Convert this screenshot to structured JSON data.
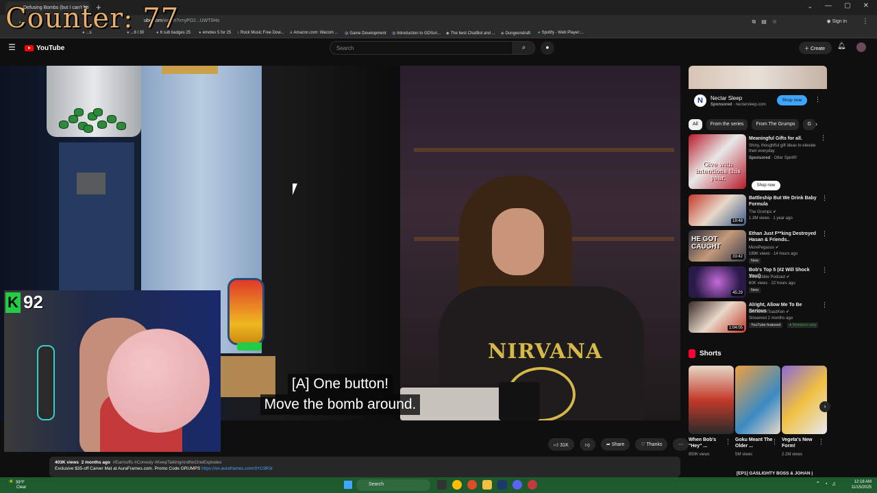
{
  "browser": {
    "tab_title": "Defusing Bombs (but I can't he",
    "url_host": "ube.com",
    "url_path": "/watch?v=yPOJ...UWT0Ho",
    "sign_in": "Sign in",
    "bookmarks": [
      {
        "label": "...s",
        "icon": "emote-icon"
      },
      {
        "label": "...6 l 30",
        "icon": "emote-icon"
      },
      {
        "label": "6 sub badges 25",
        "icon": "emote-icon"
      },
      {
        "label": "emotes 5 for 25",
        "icon": "emote-icon"
      },
      {
        "label": "Rock Music Free Dow...",
        "icon": "music-icon"
      },
      {
        "label": "Amazon.com: Wacom ...",
        "icon": "amazon-icon"
      },
      {
        "label": "Game Development",
        "icon": "globe-icon"
      },
      {
        "label": "Introduction to GDScri...",
        "icon": "globe-icon"
      },
      {
        "label": "The best ChatBot and ...",
        "icon": "bot-icon"
      },
      {
        "label": "Dungeondraft",
        "icon": "map-icon"
      },
      {
        "label": "Spotify - Web Player:...",
        "icon": "spotify-icon"
      }
    ]
  },
  "overlay": {
    "counter": "Counter: 77",
    "xp_letter": "K",
    "xp_value": "92"
  },
  "youtube": {
    "logo_text": "YouTube",
    "search_placeholder": "Search",
    "create_label": "Create"
  },
  "video": {
    "caption_line1": "[A] One button!",
    "caption_line2": "Move the bomb around.",
    "shirt_text": "NIRVANA"
  },
  "actions": {
    "likes": "31K",
    "share": "Share",
    "thanks": "Thanks"
  },
  "description": {
    "views": "403K views",
    "age": "2 months ago",
    "tags": "#Earmuffs #Comedy #KeepTalkingAndNoOneExplodes",
    "promo": "Exclusive $35-off Carver Mat at AuraFrames.com. Promo Code GRUMPS",
    "link": "https://on.auraframes.com/3YC9R3r"
  },
  "sidebar": {
    "ad": {
      "name": "Nectar Sleep",
      "sponsored": "Sponsored",
      "domain": "nectarsleep.com",
      "cta": "Shop now"
    },
    "chips": [
      "All",
      "From the series",
      "From The Grumps",
      "G"
    ],
    "gift_ad": {
      "title": "Meaningful Gifts for all.",
      "desc": "Shiny, thoughtful gift ideas to elevate their everyday",
      "sponsored": "Sponsored",
      "advertiser": "Otter Spirit®",
      "thumb_text": "Give with intentions this year.",
      "cta": "Shop now"
    },
    "recs": [
      {
        "title": "Battleship But We Drink Baby Formula",
        "channel": "The Grumps",
        "meta": "1.3M views · 1 year ago",
        "duration": "19:48",
        "badge": ""
      },
      {
        "title": "Ethan Just F**king Destroyed Hasan & Friends..",
        "channel": "MorePegasus",
        "meta": "189K views · 14 hours ago",
        "duration": "33:42",
        "badge": "New",
        "thumb_text": "HE GOT CAUGHT"
      },
      {
        "title": "Bob's Top 5 (#2 Will Shock You!)",
        "channel": "Distractible Podcast",
        "meta": "60K views · 22 hours ago",
        "duration": "45:29",
        "badge": "New"
      },
      {
        "title": "Alright, Allow Me To Be Serious",
        "channel": "CinnamonToastKen",
        "meta": "Streamed 2 months ago",
        "duration": "1:04:05",
        "badge": "YouTube featured",
        "badge2": "Members only"
      }
    ],
    "shorts_label": "Shorts",
    "shorts": [
      {
        "title": "When Bob's \"Hey\" ...",
        "views": "850K views"
      },
      {
        "title": "Goku Meant The Older ...",
        "views": "5M views"
      },
      {
        "title": "Vegeta's New Form!",
        "views": "2.2M views"
      }
    ],
    "peek_title": "[EP1] GASLIGHTY BOSS & JOHAN |"
  },
  "taskbar": {
    "temp": "59°F",
    "weather": "Clear",
    "search": "Search",
    "time": "12:18 AM",
    "date": "11/15/2025"
  },
  "colors": {
    "yt_red": "#ff0000",
    "link_blue": "#3ea6ff",
    "taskbar": "#1d5a2e",
    "counter": "#e8b06a",
    "xp_green": "#22cc44"
  }
}
